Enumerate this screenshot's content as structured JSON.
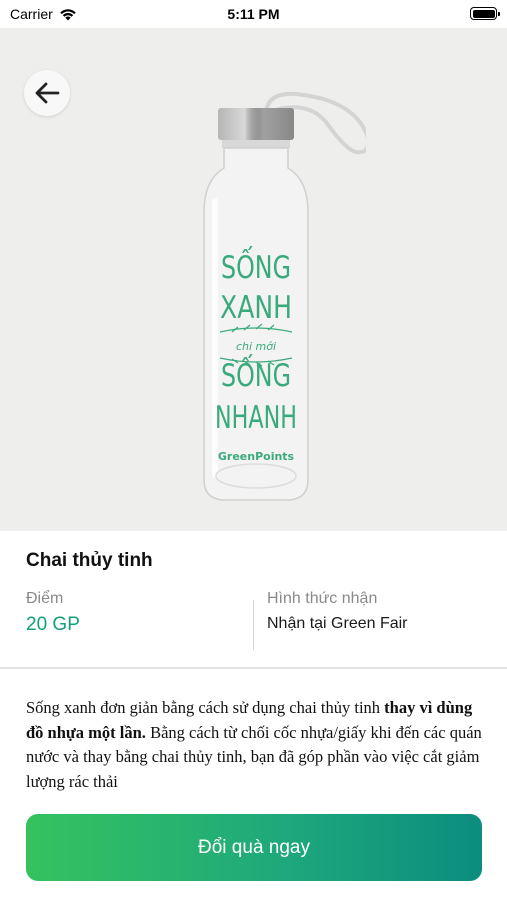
{
  "status_bar": {
    "carrier": "Carrier",
    "time": "5:11 PM"
  },
  "hero": {
    "bottle_print": {
      "line1": "SỐNG",
      "line2": "XANH",
      "script": "chi mới",
      "line3": "SỐNG",
      "line4": "NHANH",
      "brand": "GreenPoints"
    }
  },
  "product": {
    "title": "Chai thủy tinh",
    "points_label": "Điểm",
    "points_value": "20 GP",
    "method_label": "Hình thức nhận",
    "method_value": "Nhận tại Green Fair"
  },
  "description": {
    "part1": "Sống xanh đơn giản bằng cách sử dụng chai thủy tinh ",
    "bold": "thay vì dùng đồ nhựa một lần.",
    "part2": " Bằng cách từ chối cốc nhựa/giấy khi đến các quán nước và thay bằng chai thủy tinh, bạn đã góp phần vào việc cắt giảm lượng rác thải"
  },
  "actions": {
    "redeem_label": "Đổi quà ngay"
  },
  "colors": {
    "accent": "#12a07c",
    "button_start": "#35c25e",
    "button_end": "#0b8d7f",
    "print_green": "#3aaa7c"
  }
}
